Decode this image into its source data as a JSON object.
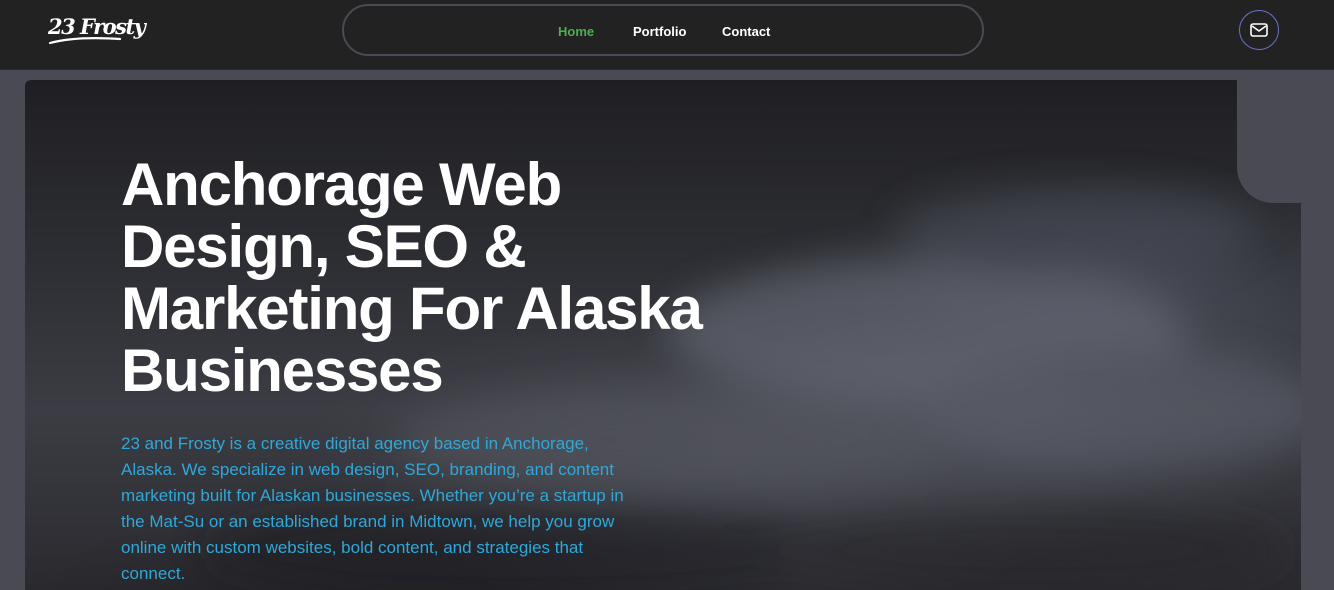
{
  "brand": {
    "logo_text": "23 Frosty"
  },
  "nav": {
    "items": [
      {
        "label": "Home",
        "active": true
      },
      {
        "label": "Portfolio",
        "active": false
      },
      {
        "label": "Contact",
        "active": false
      }
    ],
    "active_color": "#4caf50"
  },
  "header_actions": {
    "mail_icon": "mail-icon"
  },
  "hero": {
    "title": "Anchorage Web Design, SEO & Marketing For Alaska Businesses",
    "description": "23 and Frosty is a creative digital agency based in Anchorage, Alaska. We specialize in web design, SEO, branding, and content marketing built for Alaskan businesses. Whether you’re a startup in the Mat-Su or an established brand in Midtown, we help you grow online with custom websites, bold content, and strategies that connect.",
    "description_color": "#2fa8d9"
  }
}
